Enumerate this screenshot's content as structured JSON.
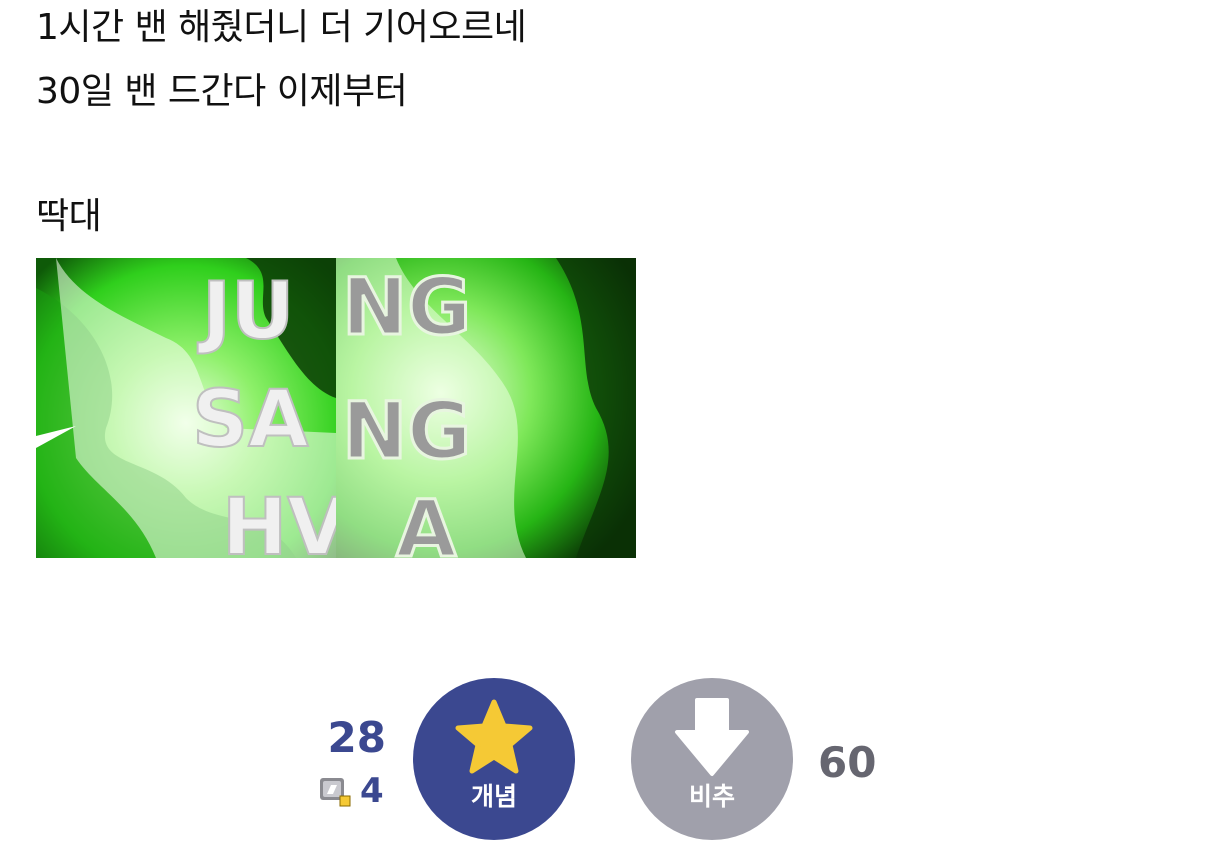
{
  "post": {
    "lines": [
      "1시간 밴 해줬더니 더 기어오르네",
      "30일 밴 드간다 이제부터",
      "딱대"
    ],
    "image": {
      "left_letters": [
        "JU",
        "SA",
        "HV"
      ],
      "right_letters": [
        "NG",
        "NG",
        "A"
      ]
    }
  },
  "vote": {
    "up_count": "28",
    "fix_count": "4",
    "up_label": "개념",
    "down_label": "비추",
    "down_count": "60"
  },
  "colors": {
    "up_button": "#3b4890",
    "down_button": "#a0a0ab",
    "star": "#f5c935",
    "glow_green": "#2fcf1c"
  }
}
